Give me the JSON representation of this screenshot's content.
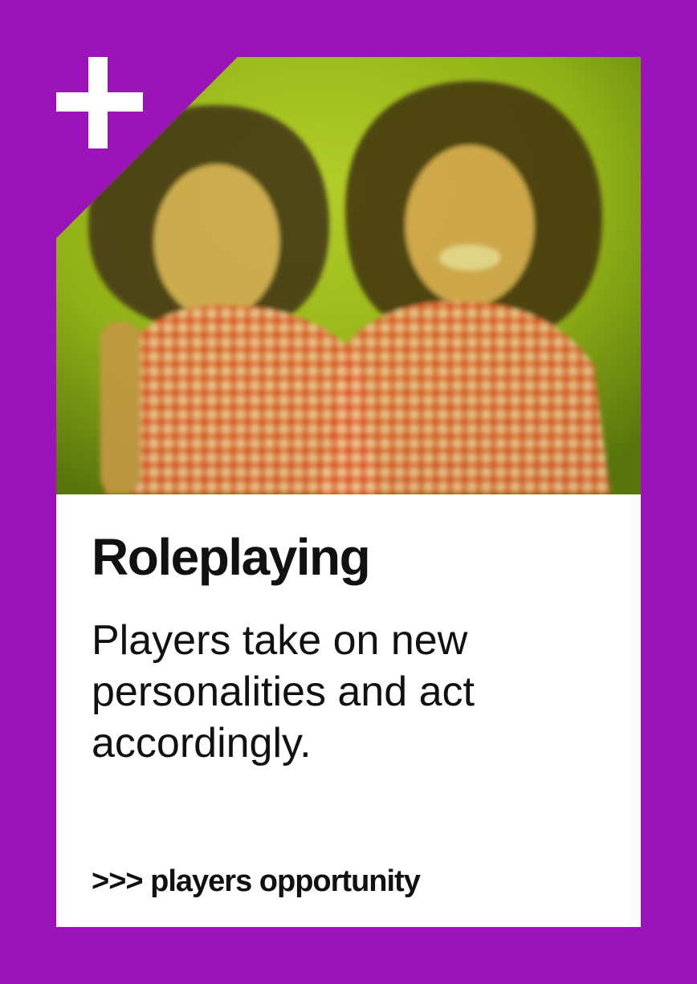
{
  "card": {
    "title": "Roleplaying",
    "description": "Players take on new personalities and act accordingly.",
    "footer": ">>> players opportunity",
    "corner_icon": "plus-icon",
    "colors": {
      "frame": "#9b14b8",
      "panel": "#ffffff",
      "text": "#111111",
      "photo_background": "#8aa816",
      "dress_gingham": "#f25a3a"
    }
  }
}
